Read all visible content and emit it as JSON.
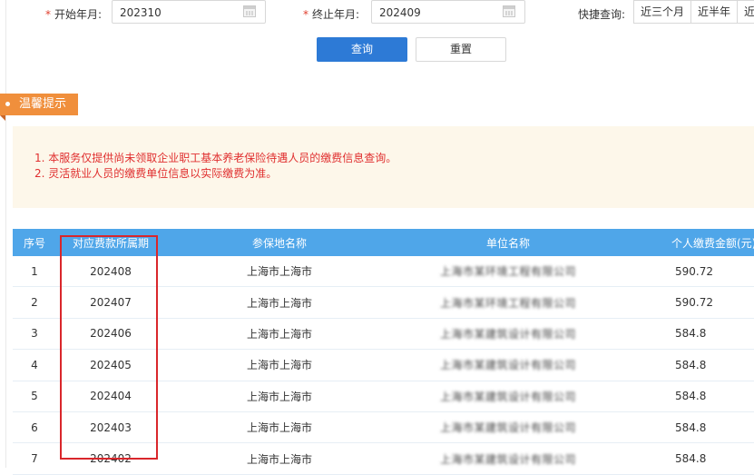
{
  "form": {
    "start_label": "开始年月:",
    "start_value": "202310",
    "end_label": "终止年月:",
    "end_value": "202409",
    "required_mark": "*",
    "quick_label": "快捷查询:",
    "quick_options": [
      "近三个月",
      "近半年",
      "近"
    ]
  },
  "actions": {
    "query_label": "查询",
    "reset_label": "重置"
  },
  "tip": {
    "title": "温馨提示",
    "lines": [
      "1. 本服务仅提供尚未领取企业职工基本养老保险待遇人员的缴费信息查询。",
      "2. 灵活就业人员的缴费单位信息以实际缴费为准。"
    ]
  },
  "table": {
    "columns": [
      "序号",
      "对应费款所属期",
      "参保地名称",
      "单位名称",
      "个人缴费金额(元)"
    ],
    "rows": [
      {
        "index": "1",
        "period": "202408",
        "location": "上海市上海市",
        "company": "上海市某环境工程有限公司",
        "amount": "590.72"
      },
      {
        "index": "2",
        "period": "202407",
        "location": "上海市上海市",
        "company": "上海市某环境工程有限公司",
        "amount": "590.72"
      },
      {
        "index": "3",
        "period": "202406",
        "location": "上海市上海市",
        "company": "上海市某建筑设计有限公司",
        "amount": "584.8"
      },
      {
        "index": "4",
        "period": "202405",
        "location": "上海市上海市",
        "company": "上海市某建筑设计有限公司",
        "amount": "584.8"
      },
      {
        "index": "5",
        "period": "202404",
        "location": "上海市上海市",
        "company": "上海市某建筑设计有限公司",
        "amount": "584.8"
      },
      {
        "index": "6",
        "period": "202403",
        "location": "上海市上海市",
        "company": "上海市某建筑设计有限公司",
        "amount": "584.8"
      },
      {
        "index": "7",
        "period": "202402",
        "location": "上海市上海市",
        "company": "上海市某建筑设计有限公司",
        "amount": "584.8"
      }
    ]
  }
}
